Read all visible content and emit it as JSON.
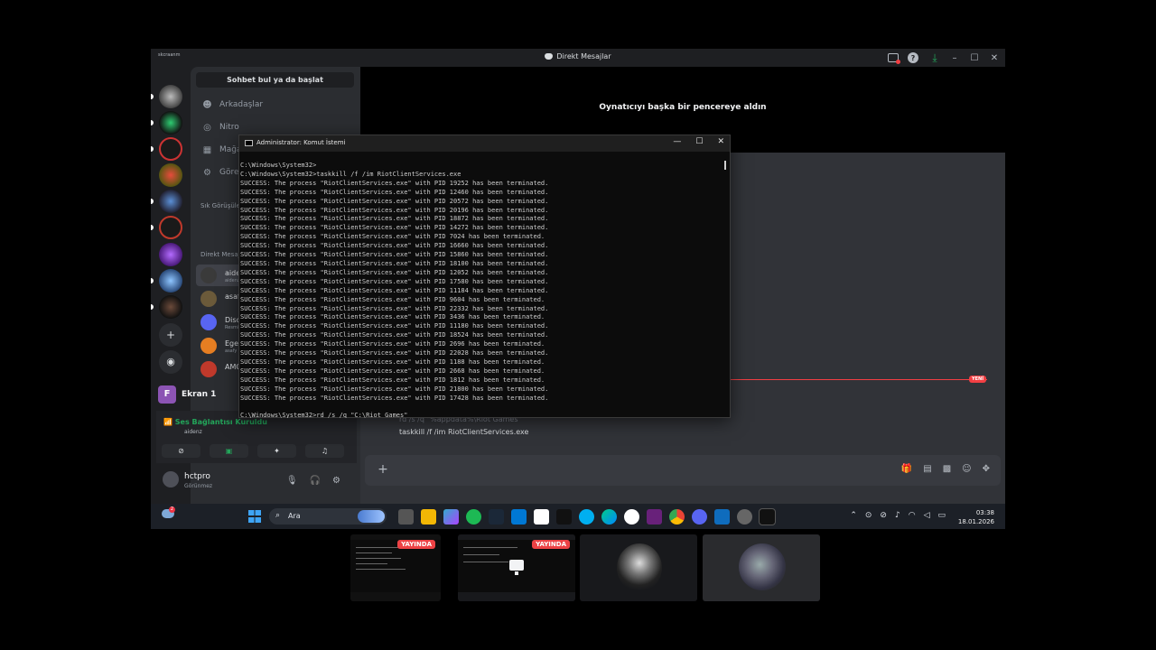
{
  "titlebar": {
    "brand": "skcraanm",
    "title": "Direkt Mesajlar"
  },
  "sidebar": {
    "search_button": "Sohbet bul ya da başlat",
    "nav": [
      {
        "label": "Arkadaşlar",
        "icon": "friends-icon"
      },
      {
        "label": "Nitro",
        "icon": "nitro-icon"
      },
      {
        "label": "Mağaza",
        "icon": "shop-icon"
      },
      {
        "label": "Görevler",
        "icon": "quests-icon"
      }
    ],
    "section_frequent": "Sık Görüşülen",
    "section_dms": "Direkt Mesajlar",
    "dms": [
      {
        "name": "aidenz",
        "sub": "aidenz",
        "color": "#3a3a3a"
      },
      {
        "name": "asaf",
        "sub": "",
        "color": "#6b5a3a"
      },
      {
        "name": "Discord",
        "sub": "Resmi",
        "color": "#5865f2"
      },
      {
        "name": "Ege",
        "sub": "asafy",
        "color": "#e67e22"
      },
      {
        "name": "AMG",
        "sub": "",
        "color": "#c0392b"
      }
    ]
  },
  "voice": {
    "screen_badge": "F",
    "screen_label": "Ekran 1",
    "status": "Ses Bağlantısı Kuruldu",
    "channel": "aidenz"
  },
  "user": {
    "name": "hctpro",
    "status": "Görünmez"
  },
  "main": {
    "popout_message": "Oynatıcıyı başka bir pencereye aldın",
    "new_badge": "YENİ",
    "msg_faded": "rd /s /q \"%appdata%\\Riot Games\"",
    "msg_line": "taskkill /f /im RiotClientServices.exe"
  },
  "cmd": {
    "title": "Administrator: Komut İstemi",
    "minimize": "—",
    "maximize": "☐",
    "close": "✕",
    "prompt1": "C:\\Windows\\System32>",
    "command1": "C:\\Windows\\System32>taskkill /f /im RiotClientServices.exe",
    "process_name": "RiotClientServices.exe",
    "pids": [
      "19252",
      "12460",
      "20572",
      "20196",
      "18872",
      "14272",
      "7024",
      "16660",
      "15860",
      "18100",
      "12052",
      "17580",
      "11184",
      "9604",
      "22332",
      "3436",
      "11180",
      "18524",
      "2696",
      "22028",
      "1188",
      "2668",
      "1812",
      "21800",
      "17428"
    ],
    "command2": "C:\\Windows\\System32>rd /s /q \"C:\\Riot Games\""
  },
  "taskbar": {
    "weather_badge": "2",
    "search_placeholder": "Ara",
    "time": "03:38",
    "date": "18.01.2026"
  },
  "thumbs": {
    "live_label_1": "YAYINDA",
    "live_label_2": "YAYINDA"
  },
  "colors": {
    "accent_green": "#23a55a",
    "accent_red": "#f23f43",
    "discord_blurple": "#5865f2"
  }
}
